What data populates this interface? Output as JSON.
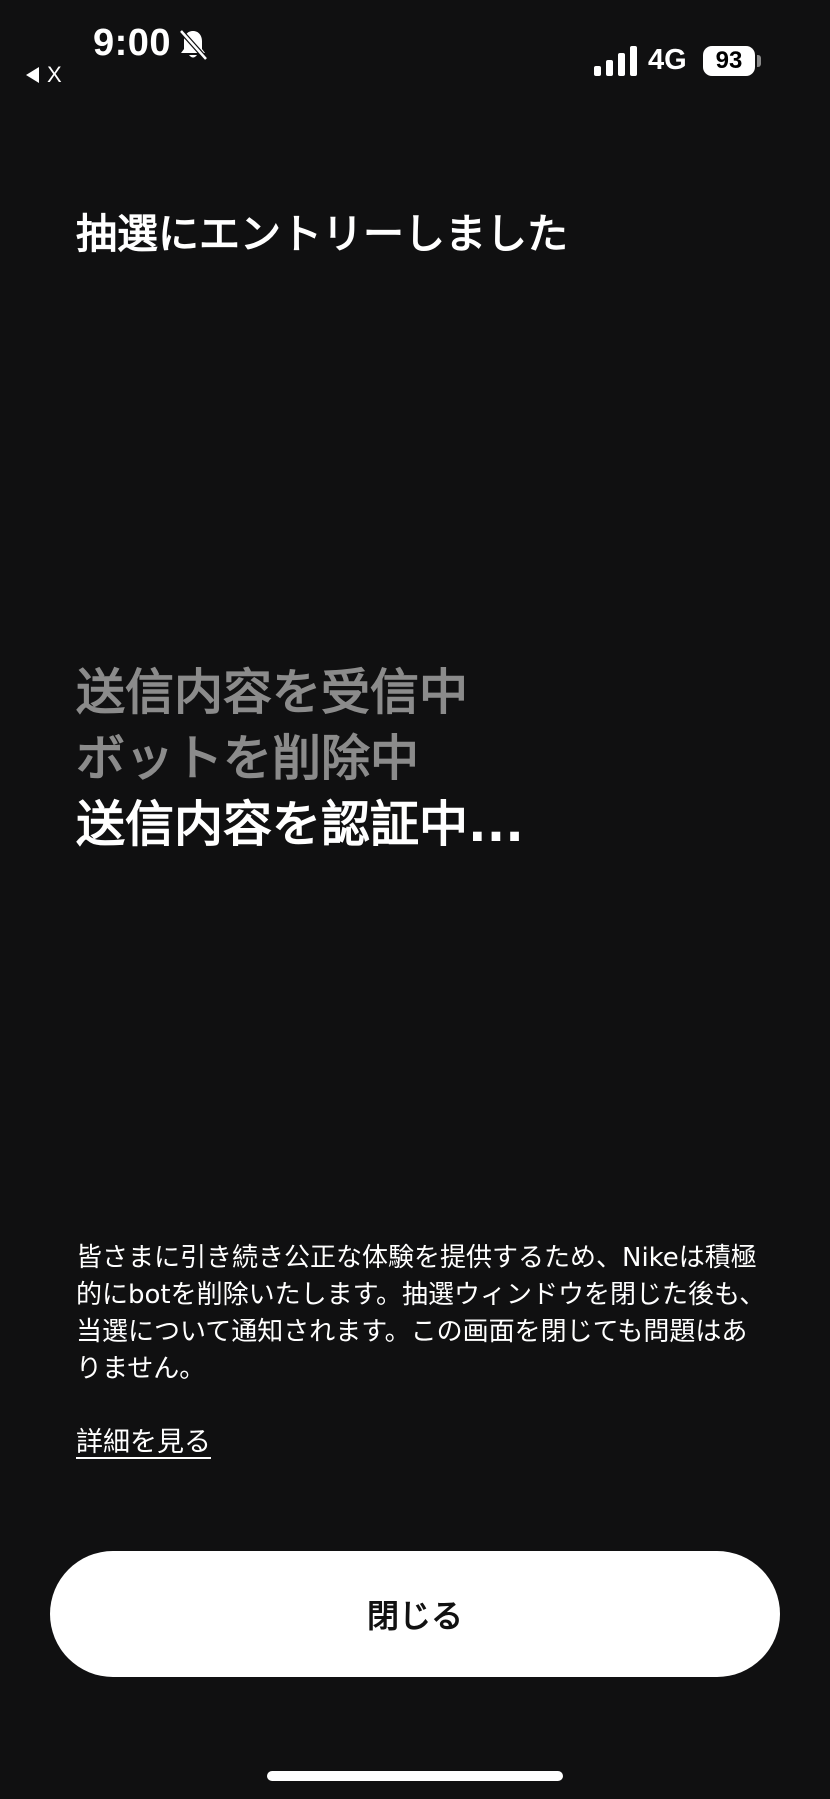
{
  "status_bar": {
    "time": "9:00",
    "back_label": "X",
    "network": "4G",
    "battery": "93",
    "icons": [
      "bell-slash-icon",
      "signal-bars-icon",
      "battery-icon"
    ]
  },
  "title": "抽選にエントリーしました",
  "steps": [
    {
      "label": "送信内容を受信中",
      "state": "done"
    },
    {
      "label": "ボットを削除中",
      "state": "done"
    },
    {
      "label": "送信内容を認証中...",
      "state": "active"
    }
  ],
  "description": "皆さまに引き続き公正な体験を提供するため、Nikeは積極的にbotを削除いたします。抽選ウィンドウを閉じた後も、当選について通知されます。この画面を閉じても問題はありません。",
  "details_link": "詳細を見る",
  "close_button": "閉じる",
  "colors": {
    "background": "#101011",
    "text": "#ffffff",
    "completed_step": "#8b8b8b",
    "button_bg": "#ffffff",
    "button_text": "#111111"
  }
}
